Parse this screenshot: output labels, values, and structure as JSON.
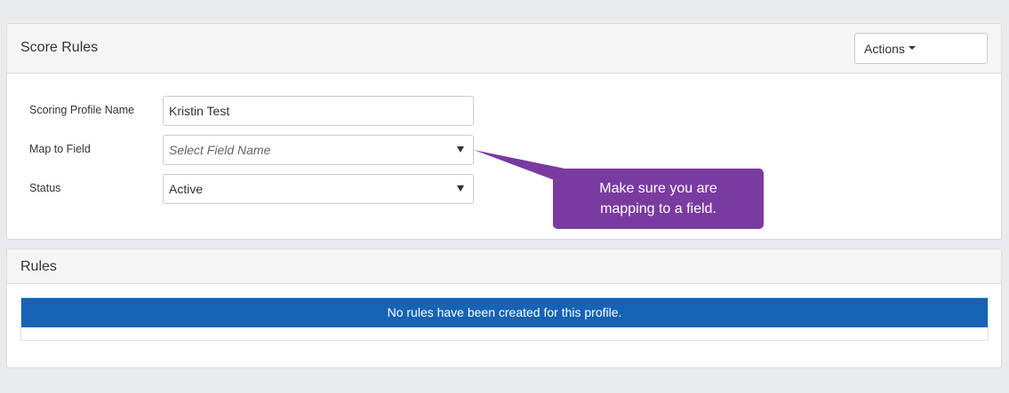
{
  "score_rules": {
    "title": "Score Rules",
    "actions_label": "Actions",
    "fields": {
      "profile_name": {
        "label": "Scoring Profile Name",
        "value": "Kristin Test"
      },
      "map_to_field": {
        "label": "Map to Field",
        "placeholder": "Select Field Name"
      },
      "status": {
        "label": "Status",
        "value": "Active"
      }
    }
  },
  "callout": {
    "text": "Make sure you are mapping to a field.",
    "color": "#7a3ba0"
  },
  "rules": {
    "title": "Rules",
    "empty_message": "No rules have been created for this profile.",
    "banner_color": "#1663b4"
  },
  "icons": {
    "actions_caret": "caret-down-icon",
    "select_arrow": "triangle-down-icon"
  }
}
